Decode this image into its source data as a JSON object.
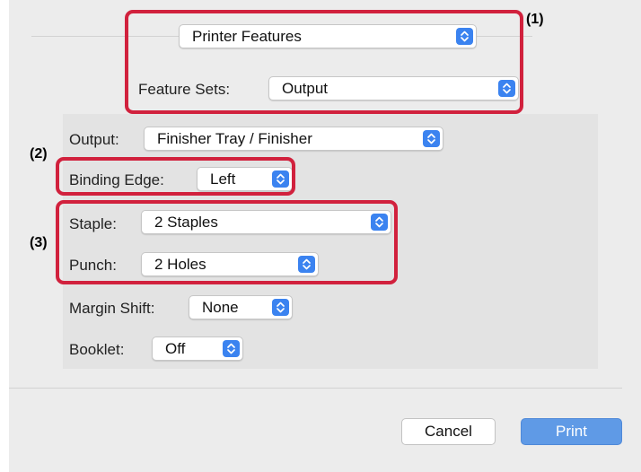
{
  "printer_features": {
    "value": "Printer Features"
  },
  "feature_sets": {
    "label": "Feature Sets:",
    "value": "Output"
  },
  "output": {
    "label": "Output:",
    "value": "Finisher Tray / Finisher"
  },
  "binding_edge": {
    "label": "Binding Edge:",
    "value": "Left"
  },
  "staple": {
    "label": "Staple:",
    "value": "2 Staples"
  },
  "punch": {
    "label": "Punch:",
    "value": "2 Holes"
  },
  "margin_shift": {
    "label": "Margin Shift:",
    "value": "None"
  },
  "booklet": {
    "label": "Booklet:",
    "value": "Off"
  },
  "callouts": {
    "one": "(1)",
    "two": "(2)",
    "three": "(3)"
  },
  "buttons": {
    "cancel": "Cancel",
    "print": "Print"
  },
  "colors": {
    "highlight": "#d1213d",
    "accent": "#3b83f0",
    "print_button": "#5f9ae6"
  }
}
